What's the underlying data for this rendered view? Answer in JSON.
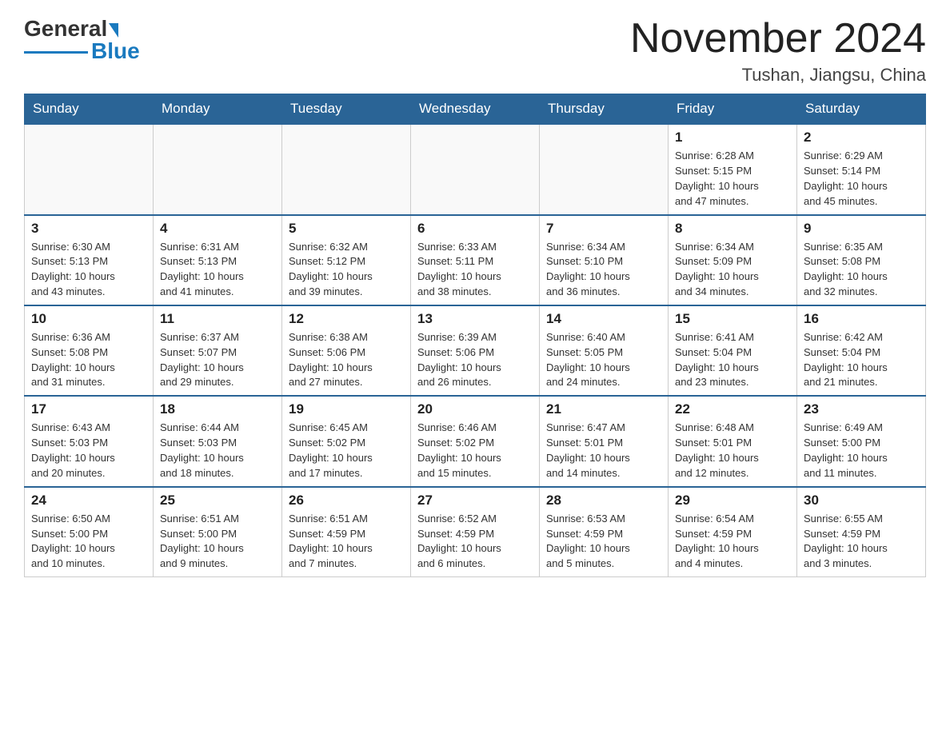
{
  "header": {
    "logo_general": "General",
    "logo_blue": "Blue",
    "title": "November 2024",
    "location": "Tushan, Jiangsu, China"
  },
  "days_of_week": [
    "Sunday",
    "Monday",
    "Tuesday",
    "Wednesday",
    "Thursday",
    "Friday",
    "Saturday"
  ],
  "weeks": [
    [
      {
        "day": "",
        "info": ""
      },
      {
        "day": "",
        "info": ""
      },
      {
        "day": "",
        "info": ""
      },
      {
        "day": "",
        "info": ""
      },
      {
        "day": "",
        "info": ""
      },
      {
        "day": "1",
        "info": "Sunrise: 6:28 AM\nSunset: 5:15 PM\nDaylight: 10 hours\nand 47 minutes."
      },
      {
        "day": "2",
        "info": "Sunrise: 6:29 AM\nSunset: 5:14 PM\nDaylight: 10 hours\nand 45 minutes."
      }
    ],
    [
      {
        "day": "3",
        "info": "Sunrise: 6:30 AM\nSunset: 5:13 PM\nDaylight: 10 hours\nand 43 minutes."
      },
      {
        "day": "4",
        "info": "Sunrise: 6:31 AM\nSunset: 5:13 PM\nDaylight: 10 hours\nand 41 minutes."
      },
      {
        "day": "5",
        "info": "Sunrise: 6:32 AM\nSunset: 5:12 PM\nDaylight: 10 hours\nand 39 minutes."
      },
      {
        "day": "6",
        "info": "Sunrise: 6:33 AM\nSunset: 5:11 PM\nDaylight: 10 hours\nand 38 minutes."
      },
      {
        "day": "7",
        "info": "Sunrise: 6:34 AM\nSunset: 5:10 PM\nDaylight: 10 hours\nand 36 minutes."
      },
      {
        "day": "8",
        "info": "Sunrise: 6:34 AM\nSunset: 5:09 PM\nDaylight: 10 hours\nand 34 minutes."
      },
      {
        "day": "9",
        "info": "Sunrise: 6:35 AM\nSunset: 5:08 PM\nDaylight: 10 hours\nand 32 minutes."
      }
    ],
    [
      {
        "day": "10",
        "info": "Sunrise: 6:36 AM\nSunset: 5:08 PM\nDaylight: 10 hours\nand 31 minutes."
      },
      {
        "day": "11",
        "info": "Sunrise: 6:37 AM\nSunset: 5:07 PM\nDaylight: 10 hours\nand 29 minutes."
      },
      {
        "day": "12",
        "info": "Sunrise: 6:38 AM\nSunset: 5:06 PM\nDaylight: 10 hours\nand 27 minutes."
      },
      {
        "day": "13",
        "info": "Sunrise: 6:39 AM\nSunset: 5:06 PM\nDaylight: 10 hours\nand 26 minutes."
      },
      {
        "day": "14",
        "info": "Sunrise: 6:40 AM\nSunset: 5:05 PM\nDaylight: 10 hours\nand 24 minutes."
      },
      {
        "day": "15",
        "info": "Sunrise: 6:41 AM\nSunset: 5:04 PM\nDaylight: 10 hours\nand 23 minutes."
      },
      {
        "day": "16",
        "info": "Sunrise: 6:42 AM\nSunset: 5:04 PM\nDaylight: 10 hours\nand 21 minutes."
      }
    ],
    [
      {
        "day": "17",
        "info": "Sunrise: 6:43 AM\nSunset: 5:03 PM\nDaylight: 10 hours\nand 20 minutes."
      },
      {
        "day": "18",
        "info": "Sunrise: 6:44 AM\nSunset: 5:03 PM\nDaylight: 10 hours\nand 18 minutes."
      },
      {
        "day": "19",
        "info": "Sunrise: 6:45 AM\nSunset: 5:02 PM\nDaylight: 10 hours\nand 17 minutes."
      },
      {
        "day": "20",
        "info": "Sunrise: 6:46 AM\nSunset: 5:02 PM\nDaylight: 10 hours\nand 15 minutes."
      },
      {
        "day": "21",
        "info": "Sunrise: 6:47 AM\nSunset: 5:01 PM\nDaylight: 10 hours\nand 14 minutes."
      },
      {
        "day": "22",
        "info": "Sunrise: 6:48 AM\nSunset: 5:01 PM\nDaylight: 10 hours\nand 12 minutes."
      },
      {
        "day": "23",
        "info": "Sunrise: 6:49 AM\nSunset: 5:00 PM\nDaylight: 10 hours\nand 11 minutes."
      }
    ],
    [
      {
        "day": "24",
        "info": "Sunrise: 6:50 AM\nSunset: 5:00 PM\nDaylight: 10 hours\nand 10 minutes."
      },
      {
        "day": "25",
        "info": "Sunrise: 6:51 AM\nSunset: 5:00 PM\nDaylight: 10 hours\nand 9 minutes."
      },
      {
        "day": "26",
        "info": "Sunrise: 6:51 AM\nSunset: 4:59 PM\nDaylight: 10 hours\nand 7 minutes."
      },
      {
        "day": "27",
        "info": "Sunrise: 6:52 AM\nSunset: 4:59 PM\nDaylight: 10 hours\nand 6 minutes."
      },
      {
        "day": "28",
        "info": "Sunrise: 6:53 AM\nSunset: 4:59 PM\nDaylight: 10 hours\nand 5 minutes."
      },
      {
        "day": "29",
        "info": "Sunrise: 6:54 AM\nSunset: 4:59 PM\nDaylight: 10 hours\nand 4 minutes."
      },
      {
        "day": "30",
        "info": "Sunrise: 6:55 AM\nSunset: 4:59 PM\nDaylight: 10 hours\nand 3 minutes."
      }
    ]
  ]
}
